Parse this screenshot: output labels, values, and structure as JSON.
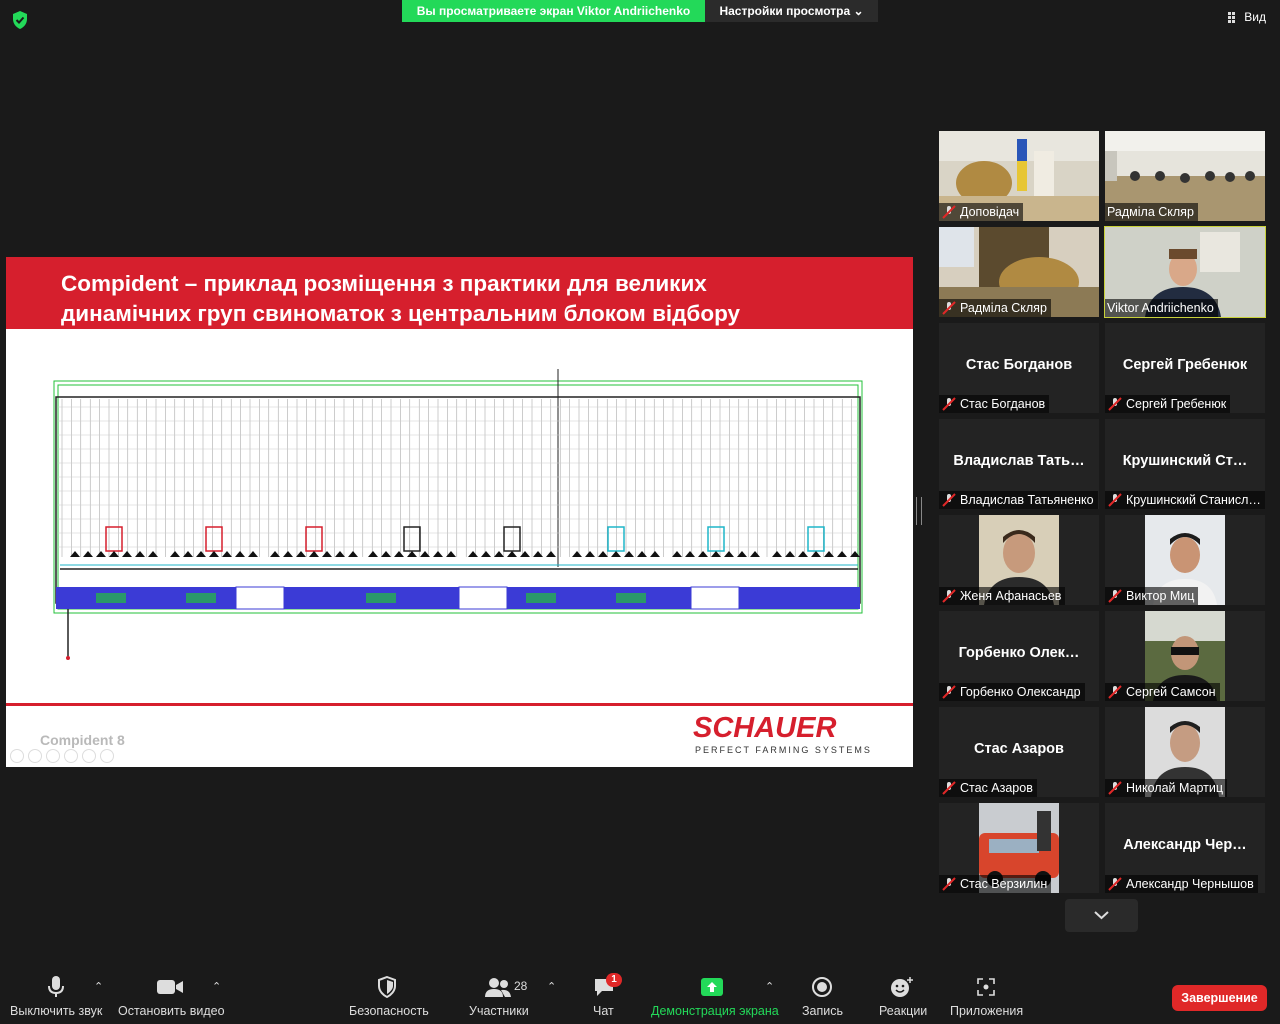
{
  "topbar": {
    "viewing_banner": "Вы просматриваете экран Viktor Andriichenko",
    "view_options": "Настройки просмотра",
    "view_label": "Вид"
  },
  "slide": {
    "title_line1": "Compident – приклад розміщення з практики для великих",
    "title_line2": "динамічних груп свиноматок з центральним блоком відбору",
    "footer_label": "Compident 8",
    "logo_main": "SCHAUER",
    "logo_sub": "PERFECT FARMING SYSTEMS",
    "colors": {
      "red": "#d61f2d",
      "green": "#23d959"
    }
  },
  "participants": [
    {
      "name": "Доповідач",
      "type": "video",
      "muted": true
    },
    {
      "name": "Радміла Скляр",
      "type": "video",
      "muted": false
    },
    {
      "name": "Радміла Скляр",
      "type": "video",
      "muted": true
    },
    {
      "name": "Viktor Andriichenko",
      "type": "video",
      "muted": false,
      "active": true
    },
    {
      "name": "Стас Богданов",
      "display": "Стас Богданов",
      "type": "name",
      "muted": true
    },
    {
      "name": "Сергей Гребенюк",
      "display": "Сергей Гребенюк",
      "type": "name",
      "muted": true
    },
    {
      "name": "Владислав Татьяненко",
      "display": "Владислав Тать…",
      "type": "name",
      "muted": true
    },
    {
      "name": "Крушинский Станисл…",
      "display": "Крушинский Ст…",
      "type": "name",
      "muted": true
    },
    {
      "name": "Женя Афанасьев",
      "type": "avatar",
      "muted": true
    },
    {
      "name": "Виктор Миц",
      "type": "avatar",
      "muted": true
    },
    {
      "name": "Горбенко Олександр",
      "display": "Горбенко Олек…",
      "type": "name",
      "muted": true
    },
    {
      "name": "Сергей Самсон",
      "type": "avatar",
      "muted": true
    },
    {
      "name": "Стас Азаров",
      "display": "Стас Азаров",
      "type": "name",
      "muted": true
    },
    {
      "name": "Николай Мартиц",
      "type": "avatar",
      "muted": true
    },
    {
      "name": "Стас Верзилин",
      "type": "avatar",
      "muted": true
    },
    {
      "name": "Александр Чернышов",
      "display": "Александр Чер…",
      "type": "name",
      "muted": true
    }
  ],
  "toolbar": {
    "mute": "Выключить звук",
    "stop_video": "Остановить видео",
    "security": "Безопасность",
    "participants": "Участники",
    "participants_count": "28",
    "chat": "Чат",
    "chat_badge": "1",
    "share": "Демонстрация экрана",
    "record": "Запись",
    "reactions": "Реакции",
    "apps": "Приложения",
    "end": "Завершение"
  }
}
